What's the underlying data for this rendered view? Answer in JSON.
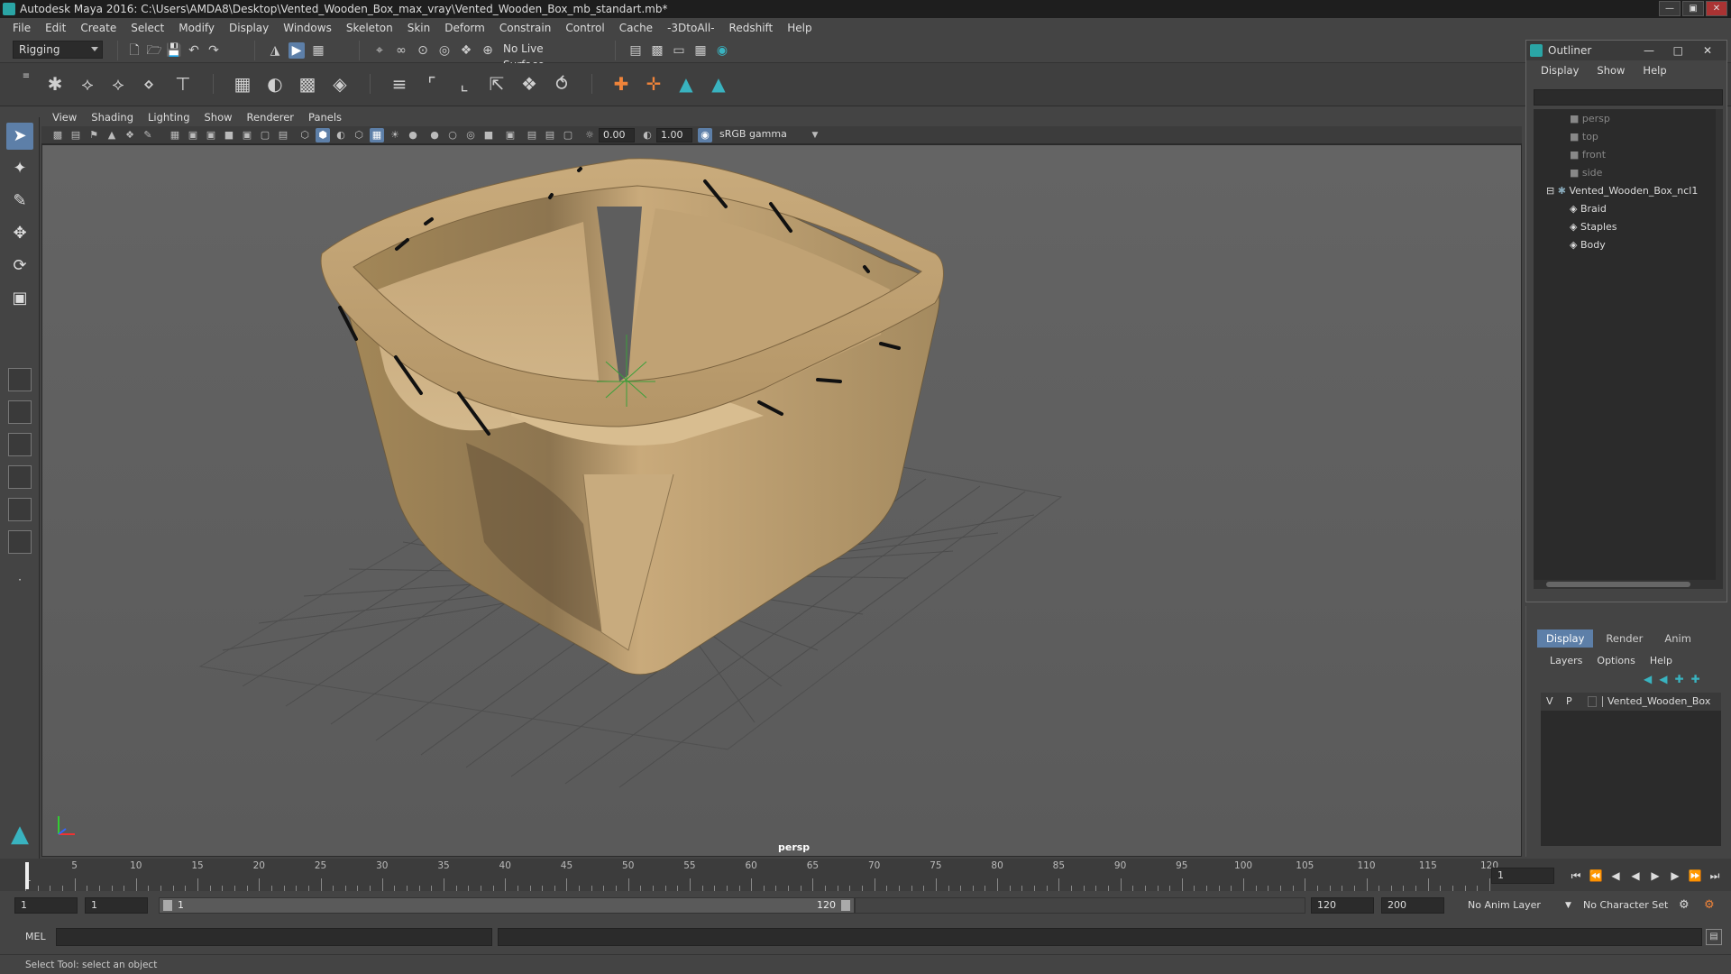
{
  "window": {
    "title": "Autodesk Maya 2016: C:\\Users\\AMDA8\\Desktop\\Vented_Wooden_Box_max_vray\\Vented_Wooden_Box_mb_standart.mb*"
  },
  "menubar": [
    "File",
    "Edit",
    "Create",
    "Select",
    "Modify",
    "Display",
    "Windows",
    "Skeleton",
    "Skin",
    "Deform",
    "Constrain",
    "Control",
    "Cache",
    "-3DtoAll-",
    "Redshift",
    "Help"
  ],
  "statusline": {
    "menuset": "Rigging",
    "live_surface": "No Live Surface"
  },
  "viewport": {
    "menu": [
      "View",
      "Shading",
      "Lighting",
      "Show",
      "Renderer",
      "Panels"
    ],
    "exposure": "0.00",
    "gamma": "1.00",
    "color_space": "sRGB gamma",
    "camera_label": "persp"
  },
  "outliner": {
    "title": "Outliner",
    "menu": [
      "Display",
      "Show",
      "Help"
    ],
    "items": [
      {
        "label": "persp",
        "dim": true
      },
      {
        "label": "top",
        "dim": true
      },
      {
        "label": "front",
        "dim": true
      },
      {
        "label": "side",
        "dim": true
      },
      {
        "label": "Vented_Wooden_Box_ncl1",
        "dim": false
      },
      {
        "label": "Braid",
        "dim": false
      },
      {
        "label": "Staples",
        "dim": false
      },
      {
        "label": "Body",
        "dim": false
      }
    ]
  },
  "channelbox": {
    "tabs": [
      "Display",
      "Render",
      "Anim"
    ],
    "active_tab": "Display",
    "menu": [
      "Layers",
      "Options",
      "Help"
    ],
    "layer": {
      "v": "V",
      "p": "P",
      "name": "Vented_Wooden_Box"
    }
  },
  "timeline": {
    "ticks": [
      "5",
      "10",
      "15",
      "20",
      "25",
      "30",
      "35",
      "40",
      "45",
      "50",
      "55",
      "60",
      "65",
      "70",
      "75",
      "80",
      "85",
      "90",
      "95",
      "100",
      "105",
      "110",
      "115",
      "120"
    ],
    "start_tick": "1",
    "current_frame": "1"
  },
  "range": {
    "start": "1",
    "playback_start": "1",
    "slider_start": "1",
    "slider_end": "120",
    "playback_end": "120",
    "end": "200",
    "anim_layer": "No Anim Layer",
    "character_set": "No Character Set"
  },
  "command": {
    "label": "MEL"
  },
  "help_line": "Select Tool: select an object"
}
